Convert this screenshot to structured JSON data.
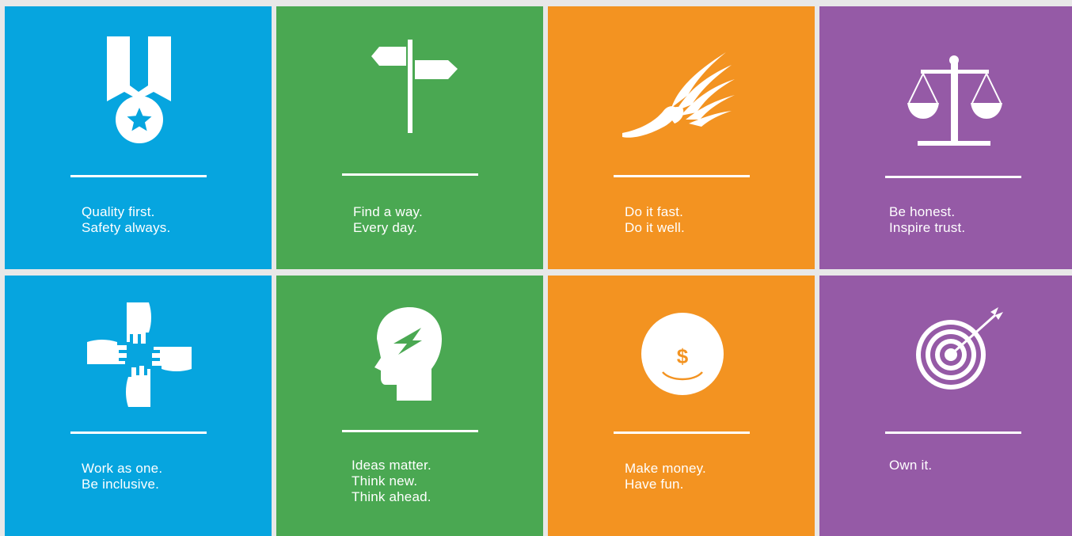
{
  "colors": {
    "blue": "#06a5df",
    "green": "#4aa852",
    "orange": "#f39321",
    "purple": "#955aa6",
    "gap": "#e8e8e8"
  },
  "tiles": [
    {
      "icon": "medal-icon",
      "lines": [
        "Quality first.",
        "Safety always."
      ]
    },
    {
      "icon": "signpost-icon",
      "lines": [
        "Find a way.",
        "Every day."
      ]
    },
    {
      "icon": "winged-foot-icon",
      "lines": [
        "Do it fast.",
        "Do it well."
      ]
    },
    {
      "icon": "scales-icon",
      "lines": [
        "Be honest.",
        "Inspire trust."
      ]
    },
    {
      "icon": "hands-icon",
      "lines": [
        "Work as one.",
        "Be inclusive."
      ]
    },
    {
      "icon": "head-lightning-icon",
      "lines": [
        "Ideas matter.",
        "Think new.",
        "Think ahead."
      ]
    },
    {
      "icon": "smiling-coin-icon",
      "coin_symbol": "$",
      "lines": [
        "Make money.",
        "Have fun."
      ]
    },
    {
      "icon": "target-arrow-icon",
      "lines": [
        "Own it."
      ]
    }
  ]
}
